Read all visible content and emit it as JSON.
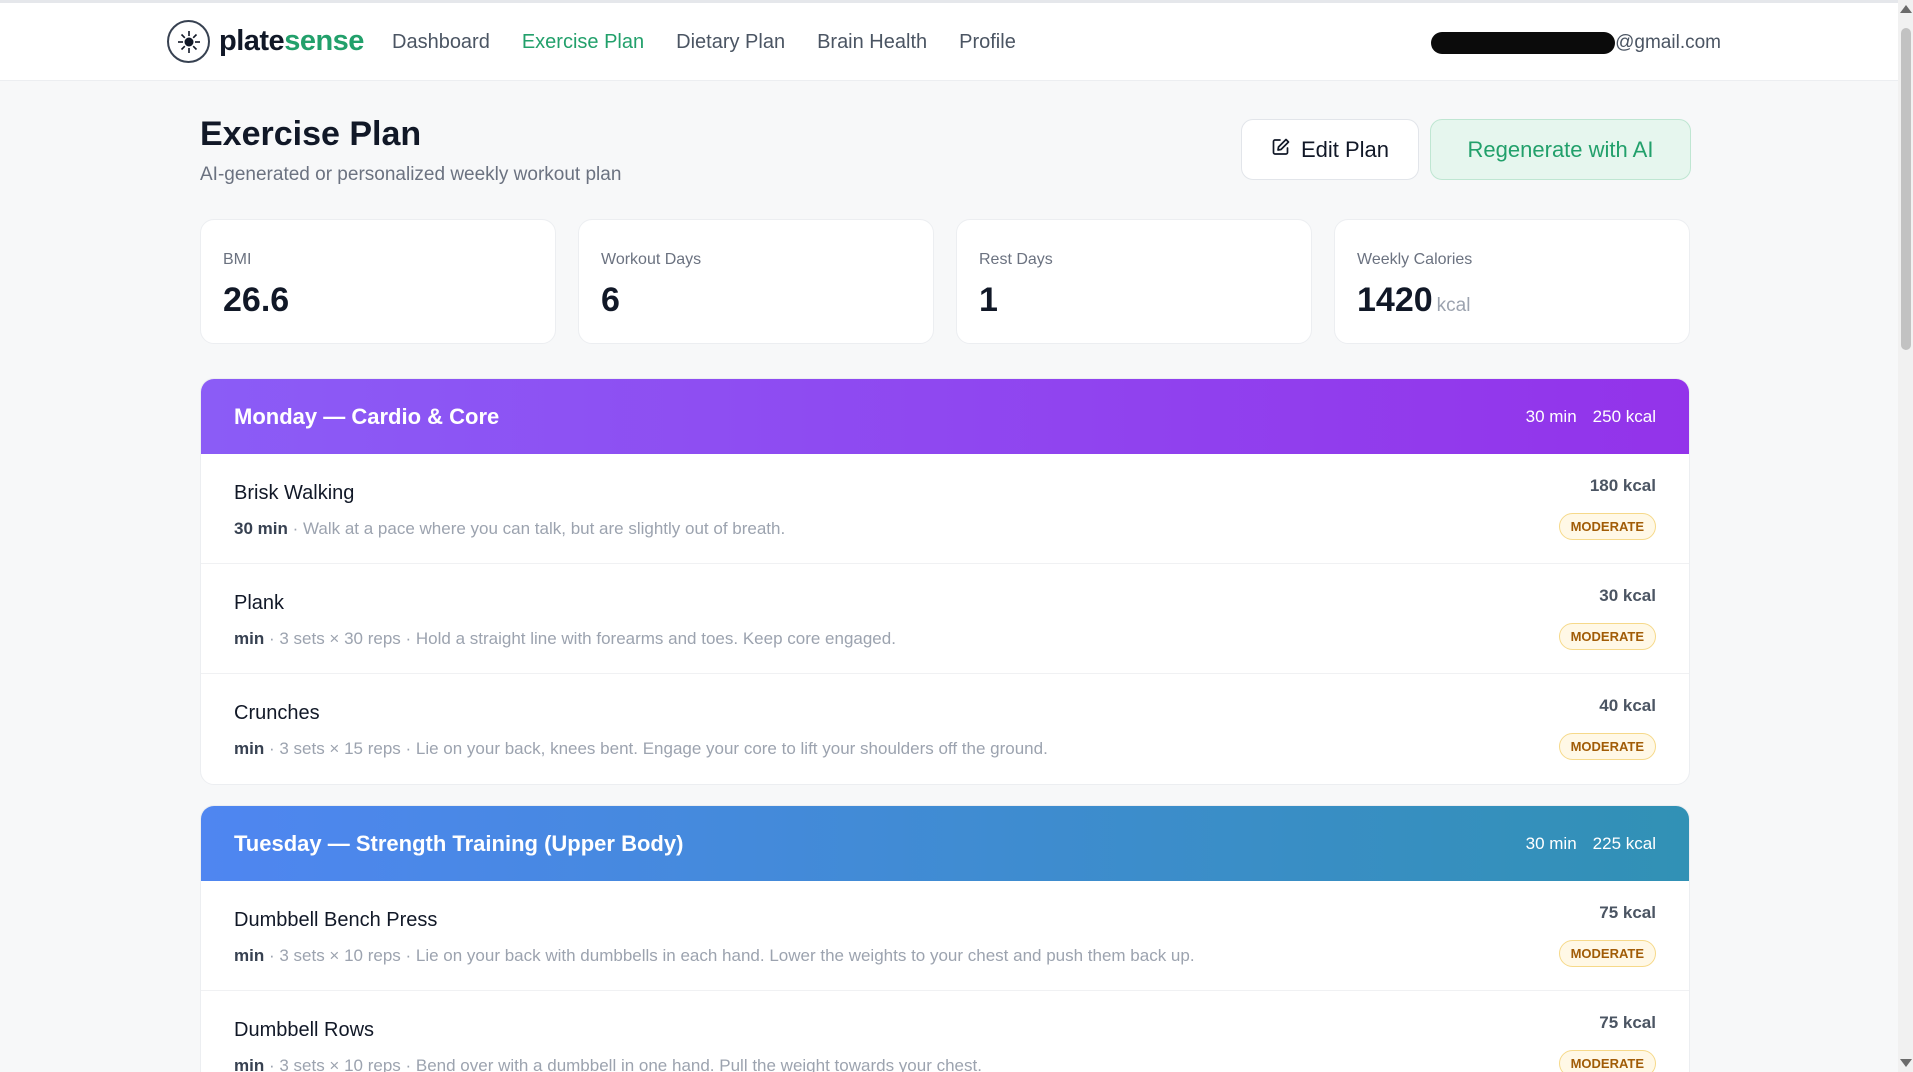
{
  "brand": {
    "part1": "plate",
    "part2": "sense"
  },
  "nav": {
    "links": [
      "Dashboard",
      "Exercise Plan",
      "Dietary Plan",
      "Brain Health",
      "Profile"
    ],
    "active": "Exercise Plan",
    "email_suffix": "@gmail.com"
  },
  "page": {
    "title": "Exercise Plan",
    "subtitle": "AI-generated or personalized weekly workout plan",
    "edit_label": "Edit Plan",
    "regen_label": "Regenerate with AI"
  },
  "stats": [
    {
      "label": "BMI",
      "value": "26.6",
      "unit": ""
    },
    {
      "label": "Workout Days",
      "value": "6",
      "unit": ""
    },
    {
      "label": "Rest Days",
      "value": "1",
      "unit": ""
    },
    {
      "label": "Weekly Calories",
      "value": "1420",
      "unit": "kcal"
    }
  ],
  "days": [
    {
      "title": "Monday — Cardio & Core",
      "duration": "30 min",
      "kcal": "250 kcal",
      "exercises": [
        {
          "name": "Brisk Walking",
          "duration": "30 min",
          "details": " · Walk at a pace where you can talk, but are slightly out of breath.",
          "kcal": "180 kcal",
          "intensity": "MODERATE"
        },
        {
          "name": "Plank",
          "duration": "min",
          "details": " · 3 sets × 30 reps · Hold a straight line with forearms and toes. Keep core engaged.",
          "kcal": "30 kcal",
          "intensity": "MODERATE"
        },
        {
          "name": "Crunches",
          "duration": "min",
          "details": " · 3 sets × 15 reps · Lie on your back, knees bent. Engage your core to lift your shoulders off the ground.",
          "kcal": "40 kcal",
          "intensity": "MODERATE"
        }
      ]
    },
    {
      "title": "Tuesday — Strength Training (Upper Body)",
      "duration": "30 min",
      "kcal": "225 kcal",
      "exercises": [
        {
          "name": "Dumbbell Bench Press",
          "duration": "min",
          "details": " · 3 sets × 10 reps · Lie on your back with dumbbells in each hand. Lower the weights to your chest and push them back up.",
          "kcal": "75 kcal",
          "intensity": "MODERATE"
        },
        {
          "name": "Dumbbell Rows",
          "duration": "min",
          "details": " · 3 sets × 10 reps · Bend over with a dumbbell in one hand. Pull the weight towards your chest.",
          "kcal": "75 kcal",
          "intensity": "MODERATE"
        }
      ]
    }
  ]
}
